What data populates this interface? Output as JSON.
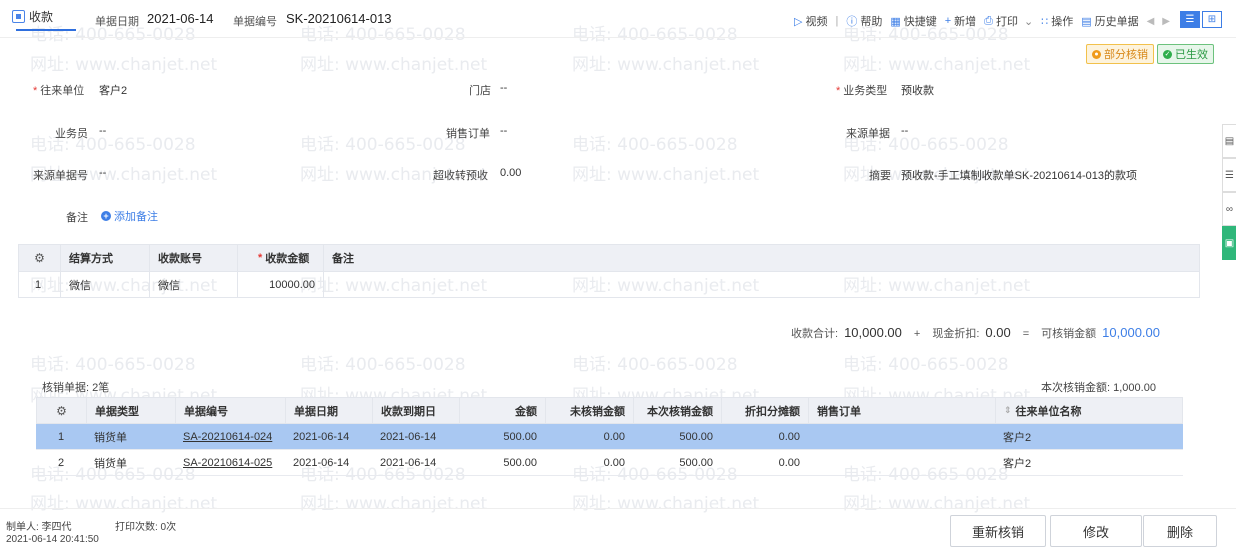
{
  "header": {
    "tab_label": "收款",
    "date_label": "单据日期",
    "date_value": "2021-06-14",
    "code_label": "单据编号",
    "code_value": "SK-20210614-013",
    "toolbar": {
      "video": "视频",
      "help": "帮助",
      "shortcut": "快捷键",
      "add": "新增",
      "print": "打印",
      "ops": "操作",
      "history": "历史单据"
    }
  },
  "status": {
    "partial": "部分核销",
    "active": "已生效"
  },
  "form": {
    "partner_label": "往来单位",
    "partner_value": "客户2",
    "store_label": "门店",
    "store_value": "--",
    "biz_type_label": "业务类型",
    "biz_type_value": "预收款",
    "salesman_label": "业务员",
    "salesman_value": "--",
    "sales_order_label": "销售订单",
    "sales_order_value": "--",
    "source_doc_label": "来源单据",
    "source_doc_value": "--",
    "source_no_label": "来源单据号",
    "source_no_value": "--",
    "over_label": "超收转预收",
    "over_value": "0.00",
    "summary_label": "摘要",
    "summary_value": "预收款-手工填制收款单SK-20210614-013的款项",
    "note_label": "备注",
    "add_note": "添加备注"
  },
  "payment_table": {
    "headers": [
      "结算方式",
      "收款账号",
      "收款金额",
      "备注"
    ],
    "rows": [
      {
        "idx": "1",
        "method": "微信",
        "account": "微信",
        "amount": "10000.00",
        "note": ""
      }
    ]
  },
  "totals": {
    "collect_label": "收款合计:",
    "collect_value": "10,000.00",
    "plus": "+",
    "discount_label": "现金折扣:",
    "discount_value": "0.00",
    "equals": "=",
    "verifiable_label": "可核销金额",
    "verifiable_value": "10,000.00"
  },
  "verification": {
    "count_label": "核销单据: 2笔",
    "this_amount_label": "本次核销金额: 1,000.00",
    "headers": [
      "单据类型",
      "单据编号",
      "单据日期",
      "收款到期日",
      "金额",
      "未核销金额",
      "本次核销金额",
      "折扣分摊额",
      "销售订单",
      "往来单位名称"
    ],
    "rows": [
      {
        "idx": "1",
        "type": "销货单",
        "code": "SA-20210614-024",
        "date": "2021-06-14",
        "due": "2021-06-14",
        "amount": "500.00",
        "unverified": "0.00",
        "this": "500.00",
        "discount": "0.00",
        "order": "",
        "partner": "客户2"
      },
      {
        "idx": "2",
        "type": "销货单",
        "code": "SA-20210614-025",
        "date": "2021-06-14",
        "due": "2021-06-14",
        "amount": "500.00",
        "unverified": "0.00",
        "this": "500.00",
        "discount": "0.00",
        "order": "",
        "partner": "客户2"
      }
    ]
  },
  "footer": {
    "maker": "制单人: 李四代",
    "print_count": "打印次数: 0次",
    "timestamp": "2021-06-14 20:41:50",
    "reverify": "重新核销",
    "modify": "修改",
    "delete": "删除"
  },
  "watermark": {
    "phone": "电话: 400-665-0028",
    "site": "网址: www.chanjet.net"
  }
}
